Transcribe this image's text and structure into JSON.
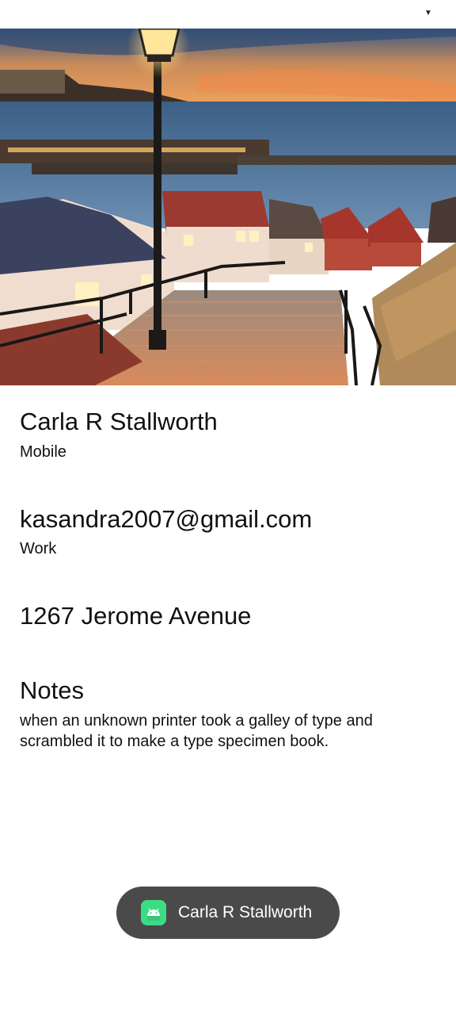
{
  "contact": {
    "name": "Carla R Stallworth",
    "name_type": "Mobile",
    "email": "kasandra2007@gmail.com",
    "email_type": "Work",
    "address": "1267 Jerome Avenue",
    "notes_heading": "Notes",
    "notes_body": "when an unknown printer took a galley of type and scrambled it to make a type specimen book."
  },
  "toast": {
    "text": "Carla R Stallworth",
    "icon": "android-icon"
  },
  "status": {
    "icon": "signal-icon"
  },
  "colors": {
    "toast_bg": "#4a4a4a",
    "android_green": "#3ddc84"
  }
}
